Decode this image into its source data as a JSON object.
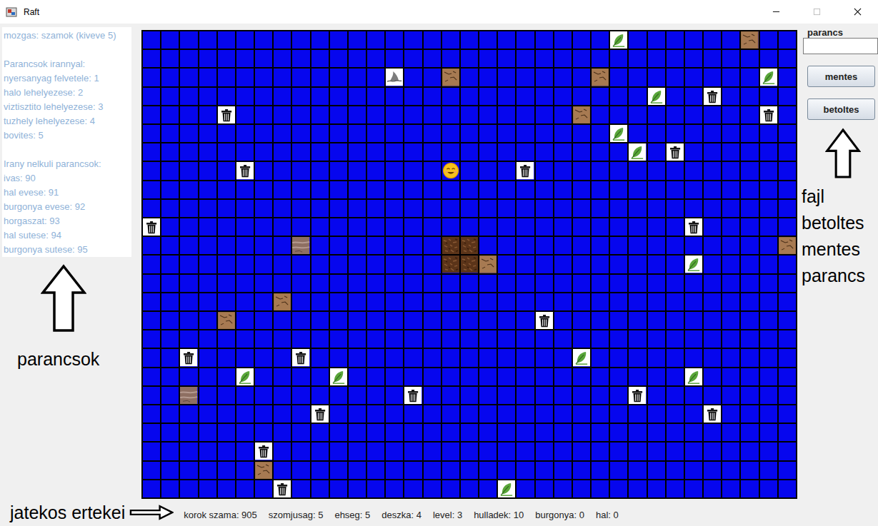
{
  "window": {
    "title": "Raft"
  },
  "help": [
    [
      "mozgas: szamok (kiveve 5)"
    ],
    [
      "Parancsok irannyal:",
      "nyersanyag felvetele: 1",
      "halo lehelyezese: 2",
      "viztisztito lehelyezese: 3",
      "tuzhely lehelyezese: 4",
      "bovites: 5"
    ],
    [
      "Irany nelkuli parancsok:",
      "ivas: 90",
      "hal evese: 91",
      "burgonya evese: 92",
      "horgaszat: 93",
      "hal sutese: 94",
      "burgonya sutese: 95"
    ]
  ],
  "board": {
    "columns": 35,
    "rows": 25,
    "cells": [
      {
        "row": 0,
        "col": 25,
        "kind": "leaf"
      },
      {
        "row": 0,
        "col": 32,
        "kind": "wood"
      },
      {
        "row": 2,
        "col": 13,
        "kind": "shark"
      },
      {
        "row": 2,
        "col": 16,
        "kind": "wood"
      },
      {
        "row": 2,
        "col": 24,
        "kind": "wood"
      },
      {
        "row": 2,
        "col": 33,
        "kind": "leaf"
      },
      {
        "row": 3,
        "col": 27,
        "kind": "leaf"
      },
      {
        "row": 3,
        "col": 30,
        "kind": "trash"
      },
      {
        "row": 4,
        "col": 4,
        "kind": "trash"
      },
      {
        "row": 4,
        "col": 23,
        "kind": "wood"
      },
      {
        "row": 4,
        "col": 33,
        "kind": "trash"
      },
      {
        "row": 5,
        "col": 25,
        "kind": "leaf"
      },
      {
        "row": 6,
        "col": 26,
        "kind": "leaf"
      },
      {
        "row": 6,
        "col": 28,
        "kind": "trash"
      },
      {
        "row": 7,
        "col": 5,
        "kind": "trash"
      },
      {
        "row": 7,
        "col": 16,
        "kind": "player"
      },
      {
        "row": 7,
        "col": 20,
        "kind": "trash"
      },
      {
        "row": 10,
        "col": 0,
        "kind": "trash"
      },
      {
        "row": 10,
        "col": 29,
        "kind": "trash"
      },
      {
        "row": 11,
        "col": 8,
        "kind": "stone"
      },
      {
        "row": 11,
        "col": 16,
        "kind": "raft"
      },
      {
        "row": 11,
        "col": 17,
        "kind": "raft"
      },
      {
        "row": 11,
        "col": 34,
        "kind": "wood"
      },
      {
        "row": 12,
        "col": 16,
        "kind": "raft"
      },
      {
        "row": 12,
        "col": 17,
        "kind": "raft"
      },
      {
        "row": 12,
        "col": 18,
        "kind": "wood"
      },
      {
        "row": 12,
        "col": 29,
        "kind": "leaf"
      },
      {
        "row": 14,
        "col": 7,
        "kind": "wood"
      },
      {
        "row": 15,
        "col": 4,
        "kind": "wood"
      },
      {
        "row": 15,
        "col": 21,
        "kind": "trash"
      },
      {
        "row": 17,
        "col": 2,
        "kind": "trash"
      },
      {
        "row": 17,
        "col": 8,
        "kind": "trash"
      },
      {
        "row": 17,
        "col": 23,
        "kind": "leaf"
      },
      {
        "row": 18,
        "col": 5,
        "kind": "leaf"
      },
      {
        "row": 18,
        "col": 10,
        "kind": "leaf"
      },
      {
        "row": 18,
        "col": 29,
        "kind": "leaf"
      },
      {
        "row": 19,
        "col": 2,
        "kind": "stone"
      },
      {
        "row": 19,
        "col": 14,
        "kind": "trash"
      },
      {
        "row": 19,
        "col": 26,
        "kind": "trash"
      },
      {
        "row": 20,
        "col": 9,
        "kind": "trash"
      },
      {
        "row": 20,
        "col": 30,
        "kind": "trash"
      },
      {
        "row": 22,
        "col": 6,
        "kind": "trash"
      },
      {
        "row": 23,
        "col": 6,
        "kind": "wood"
      },
      {
        "row": 24,
        "col": 7,
        "kind": "trash"
      },
      {
        "row": 24,
        "col": 19,
        "kind": "leaf"
      }
    ]
  },
  "command": {
    "label": "parancs",
    "value": ""
  },
  "buttons": [
    "mentes",
    "betoltes"
  ],
  "annotations": {
    "left": "parancsok",
    "right": [
      "fajl",
      "betoltes",
      "mentes",
      "parancs"
    ],
    "bottom": "jatekos ertekei"
  },
  "status_bar": [
    "korok szama: 905",
    "szomjusag: 5",
    "ehseg: 5",
    "deszka: 4",
    "level: 3",
    "hulladek: 10",
    "burgonya: 0",
    "hal: 0"
  ]
}
